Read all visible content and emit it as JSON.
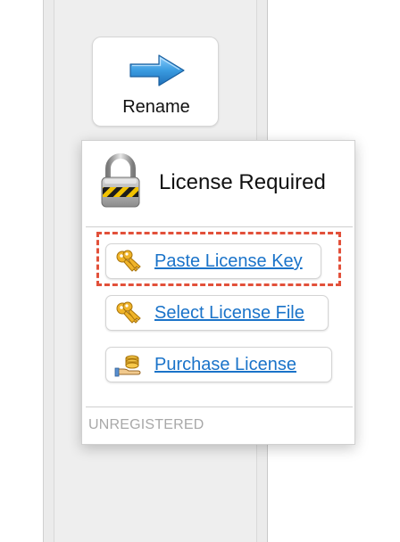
{
  "toolbar": {
    "rename_label": "Rename",
    "rename_icon": "arrow-right-icon"
  },
  "license_panel": {
    "title": "License Required",
    "title_icon": "padlock-icon",
    "actions": [
      {
        "label": "Paste License Key",
        "icon": "keys-icon",
        "highlighted": true
      },
      {
        "label": "Select License File",
        "icon": "keys-icon",
        "highlighted": false
      },
      {
        "label": "Purchase License",
        "icon": "coins-hand-icon",
        "highlighted": false
      }
    ],
    "status": "UNREGISTERED"
  },
  "colors": {
    "link": "#1a73c9",
    "highlight_border": "#e2503a",
    "status_text": "#a8a8a8",
    "arrow_blue": "#3a9be0"
  }
}
